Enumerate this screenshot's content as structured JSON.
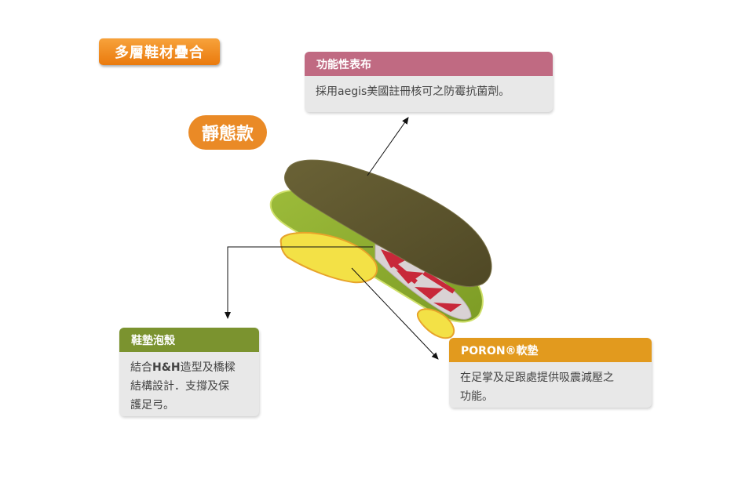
{
  "title_tag": "多層鞋材疊合",
  "model_pill": "靜態款",
  "cards": {
    "fabric": {
      "title": "功能性表布",
      "body": "採用aegis美國註冊核可之防霉抗菌劑。",
      "color": "#c06a82"
    },
    "shell": {
      "title": "鞋墊泡殼",
      "line1_pre": "結合",
      "line1_bold": "H&H",
      "line1_post": "造型及橋樑",
      "line2": "結構設計．支撐及保",
      "line3": "護足弓。",
      "color": "#7b932f"
    },
    "poron": {
      "title": "PORON®軟墊",
      "line1": "在足掌及足跟處提供吸震減壓之",
      "line2": "功能。",
      "color": "#e29a1e"
    }
  },
  "colors": {
    "top_fabric": "#5e5731",
    "shell": "#93b234",
    "poron": "#f3e146",
    "red_bridge": "#c8283a"
  }
}
